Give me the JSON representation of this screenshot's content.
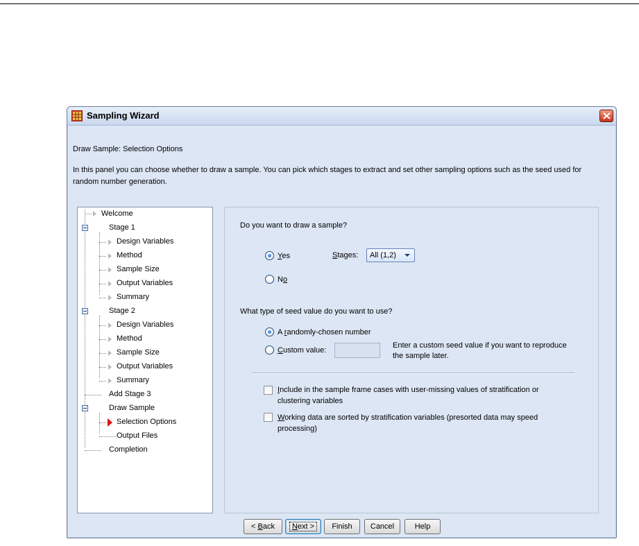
{
  "window": {
    "title": "Sampling Wizard",
    "icon": "table-grid-icon",
    "close_icon": "close-x-icon"
  },
  "panel": {
    "heading": "Draw Sample: Selection Options",
    "description": "In this panel you can choose whether to draw  a sample. You can pick which stages to extract and set other sampling options such as the seed used for random number generation."
  },
  "tree": {
    "items": [
      {
        "label": "Welcome"
      },
      {
        "label": "Stage 1"
      },
      {
        "label": "Design Variables"
      },
      {
        "label": "Method"
      },
      {
        "label": "Sample Size"
      },
      {
        "label": "Output Variables"
      },
      {
        "label": "Summary"
      },
      {
        "label": "Stage 2"
      },
      {
        "label": "Design Variables"
      },
      {
        "label": "Method"
      },
      {
        "label": "Sample Size"
      },
      {
        "label": "Output Variables"
      },
      {
        "label": "Summary"
      },
      {
        "label": "Add Stage 3"
      },
      {
        "label": "Draw Sample"
      },
      {
        "label": "Selection Options"
      },
      {
        "label": "Output Files"
      },
      {
        "label": "Completion"
      }
    ],
    "active": "Selection Options"
  },
  "draw": {
    "question": "Do you want to draw a sample?",
    "yes_mnemonic": "Y",
    "yes_rest": "es",
    "no_prefix": "N",
    "no_mnemonic": "o",
    "selected": "Yes",
    "stages_mnemonic": "S",
    "stages_rest": "tages:",
    "stages_value": "All (1,2)"
  },
  "seed": {
    "question": "What type of seed value do you want to use?",
    "random_prefix": "A ",
    "random_mnemonic": "r",
    "random_rest": "andomly-chosen number",
    "custom_mnemonic": "C",
    "custom_rest": "ustom value:",
    "custom_value": "",
    "selected": "A randomly-chosen number",
    "hint_line1": "Enter a custom seed value if you want to reproduce",
    "hint_line2": "the sample later."
  },
  "options": {
    "include_mnemonic": "I",
    "include_line1_rest": "nclude in the sample frame cases with user-missing values of stratification or",
    "include_line2": "clustering variables",
    "include_checked": false,
    "sorted_mnemonic": "W",
    "sorted_line1_rest": "orking data are sorted by stratification variables (presorted data may speed",
    "sorted_line2": "processing)",
    "sorted_checked": false
  },
  "buttons": {
    "back_prefix": "< ",
    "back_mnemonic": "B",
    "back_rest": "ack",
    "next_mnemonic": "N",
    "next_rest": "ext >",
    "finish": "Finish",
    "cancel": "Cancel",
    "help": "Help"
  }
}
